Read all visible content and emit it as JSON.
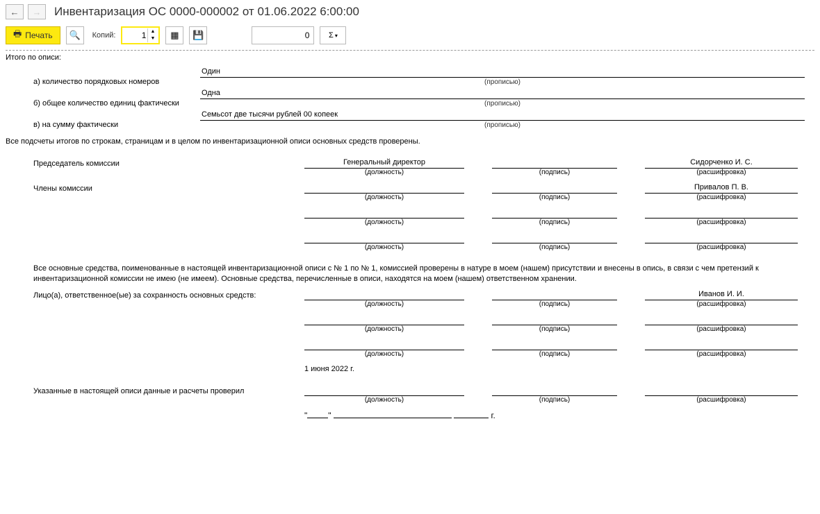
{
  "header": {
    "title": "Инвентаризация ОС 0000-000002 от 01.06.2022 6:00:00"
  },
  "toolbar": {
    "print_label": "Печать",
    "copies_label": "Копий:",
    "copies_value": "1",
    "sum_value": "0",
    "sigma": "Σ"
  },
  "doc": {
    "totals_header": "Итого по описи:",
    "rows": {
      "a": {
        "label": "а) количество порядковых номеров",
        "value": "Один",
        "caption": "(прописью)"
      },
      "b": {
        "label": "б) общее количество единиц фактически",
        "value": "Одна",
        "caption": "(прописью)"
      },
      "c": {
        "label": "в) на сумму фактически",
        "value": "Семьсот две тысячи рублей 00 копеек",
        "caption": "(прописью)"
      }
    },
    "checked_line": "Все подсчеты итогов по строкам, страницам и в целом по инвентаризационной описи основных средств проверены.",
    "commission_chair_label": "Председатель комиссии",
    "commission_members_label": "Члены комиссии",
    "captions": {
      "position": "(должность)",
      "signature": "(подпись)",
      "decoding": "(расшифровка)"
    },
    "chair": {
      "position": "Генеральный директор",
      "decoding": "Сидорченко И. С."
    },
    "member1": {
      "position": "",
      "decoding": "Привалов П. В."
    },
    "body_text": "Все основные средства, поименованные в настоящей инвентаризационной описи с № 1 по № 1, комиссией проверены в натуре в моем (нашем) присутствии и внесены в опись, в связи с чем претензий к инвентаризационной комиссии не имею (не имеем). Основные средства, перечисленные в описи, находятся на моем (нашем) ответственном хранении.",
    "responsible_label": "Лицо(а), ответственное(ые) за сохранность основных средств:",
    "responsible1": {
      "decoding": "Иванов И. И."
    },
    "date_text": "1 июня 2022 г.",
    "verified_label": "Указанные в настоящей описи данные и расчеты проверил",
    "date_blank_suffix": "г."
  }
}
